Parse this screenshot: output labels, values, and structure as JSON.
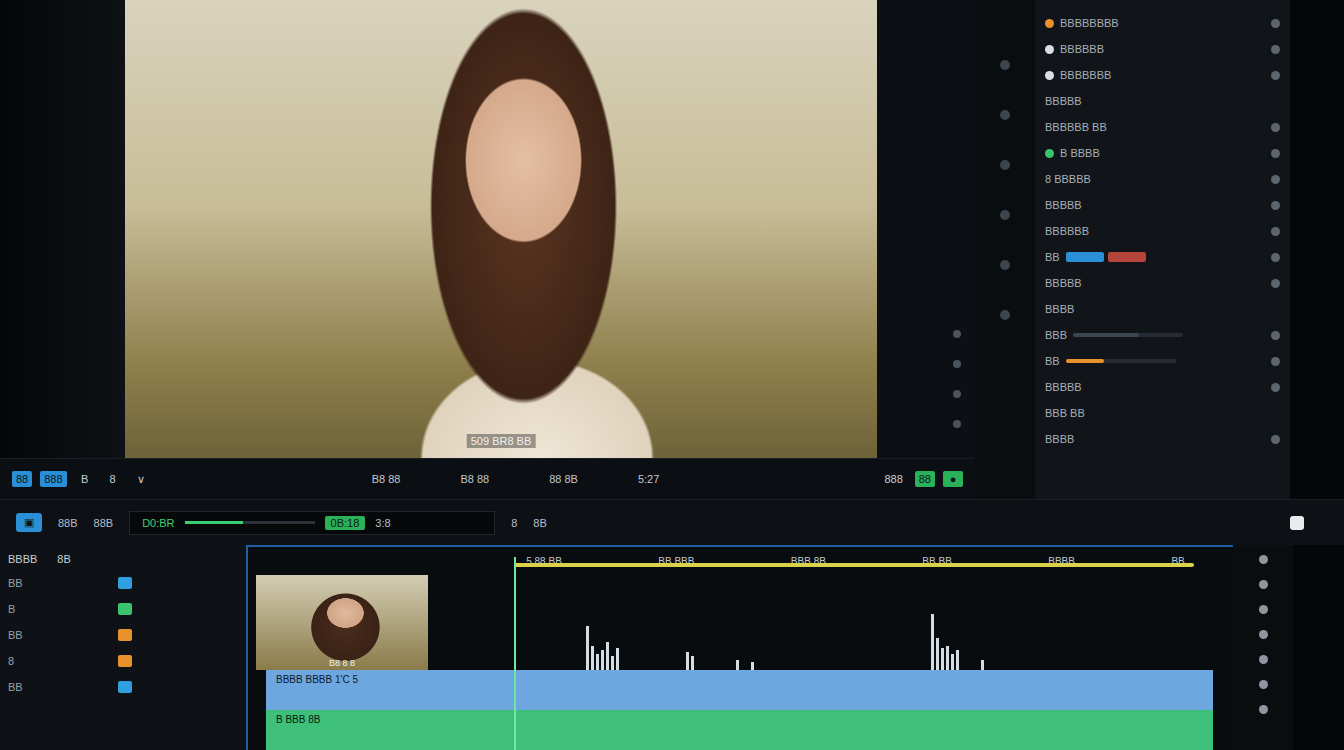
{
  "viewer": {
    "caption": "509 BR8 BB"
  },
  "viewer_toolbar": {
    "left": [
      {
        "label": "88",
        "selected": true
      },
      {
        "label": "888",
        "selected": true
      },
      {
        "label": "B",
        "selected": false
      },
      {
        "label": "8",
        "selected": false
      },
      {
        "label": "∨",
        "selected": false
      }
    ],
    "center": [
      "B8 88",
      "B8 88",
      "88 8B",
      "5:27"
    ],
    "right": [
      {
        "label": "888",
        "selected": false
      },
      {
        "label": "88",
        "selected": true
      },
      {
        "label": "●",
        "selected": true
      }
    ]
  },
  "transport": {
    "left_button": "▣",
    "left_labels": [
      "88B",
      "88B"
    ],
    "timecode": "D0:BR",
    "scrub_level": 0.45,
    "scrub_value": "0B:18",
    "after": "3:8",
    "right": [
      "8",
      "8B"
    ],
    "toggle": true
  },
  "right_panel": {
    "rows": [
      {
        "kind": "dot",
        "label": "BBBBBBBB",
        "color": "#e8922c",
        "toggle": true
      },
      {
        "kind": "dot",
        "label": "BBBBBB",
        "color": "#d8dde2",
        "toggle": true
      },
      {
        "kind": "dot",
        "label": "BBBBBBB",
        "color": "#d8dde2",
        "toggle": true
      },
      {
        "kind": "text",
        "label": "BBBBB",
        "toggle": false
      },
      {
        "kind": "text",
        "label": "BBBBBB BB",
        "toggle": true
      },
      {
        "kind": "dot",
        "label": "B BBBB",
        "color": "#37c46a",
        "toggle": true
      },
      {
        "kind": "text",
        "label": "8 BBBBB",
        "toggle": true
      },
      {
        "kind": "text",
        "label": "BBBBB",
        "toggle": true
      },
      {
        "kind": "text",
        "label": "BBBBBB",
        "toggle": true
      },
      {
        "kind": "chips",
        "label": "BB",
        "toggle": true
      },
      {
        "kind": "text",
        "label": "BBBBB",
        "toggle": true
      },
      {
        "kind": "text",
        "label": "BBBB",
        "toggle": false
      },
      {
        "kind": "slider",
        "label": "BBB",
        "level": 0.6,
        "color": "#3c4550",
        "toggle": true
      },
      {
        "kind": "slider",
        "label": "BB",
        "level": 0.35,
        "color": "#e8922c",
        "toggle": true
      },
      {
        "kind": "text",
        "label": "BBBBB",
        "toggle": true
      },
      {
        "kind": "text",
        "label": "BBB BB",
        "toggle": false
      },
      {
        "kind": "text",
        "label": "BBBB",
        "toggle": true
      }
    ]
  },
  "timeline": {
    "header": [
      "BBBB",
      "8B"
    ],
    "tracks": [
      {
        "label": "BB",
        "color": "#2f9fe0"
      },
      {
        "label": "B",
        "color": "#37c46a"
      },
      {
        "label": "BB",
        "color": "#e8922c"
      },
      {
        "label": "8",
        "color": "#e8922c"
      },
      {
        "label": "BB",
        "color": "#2f9fe0"
      }
    ],
    "ruler": [
      "5 88 BB",
      "BB BBB",
      "BBB 8B",
      "BB BB",
      "BBBB",
      "BB"
    ],
    "thumbnail_caption": "B8 8 8",
    "waveform": [
      0,
      0,
      0,
      0,
      0,
      0,
      0,
      0,
      0,
      0,
      0,
      0,
      0,
      0,
      0,
      0,
      0,
      0,
      0,
      0,
      0,
      0,
      0,
      0,
      0,
      0,
      0,
      0,
      0,
      0,
      55,
      30,
      20,
      25,
      35,
      18,
      28,
      0,
      0,
      0,
      0,
      0,
      0,
      0,
      0,
      0,
      0,
      0,
      0,
      0,
      22,
      18,
      0,
      0,
      0,
      0,
      0,
      0,
      0,
      0,
      12,
      0,
      0,
      10,
      0,
      0,
      0,
      0,
      0,
      0,
      0,
      0,
      0,
      0,
      0,
      0,
      0,
      0,
      0,
      0,
      0,
      0,
      0,
      0,
      0,
      0,
      0,
      0,
      0,
      0,
      0,
      0,
      0,
      0,
      0,
      0,
      0,
      0,
      0,
      70,
      40,
      28,
      30,
      20,
      25,
      0,
      0,
      0,
      0,
      12,
      0,
      0
    ],
    "blue_clip": "BBBB BBBB 1'C 5",
    "green_clip": "B BBB 8B",
    "playhead": 0.27,
    "range_end": 0.96
  }
}
